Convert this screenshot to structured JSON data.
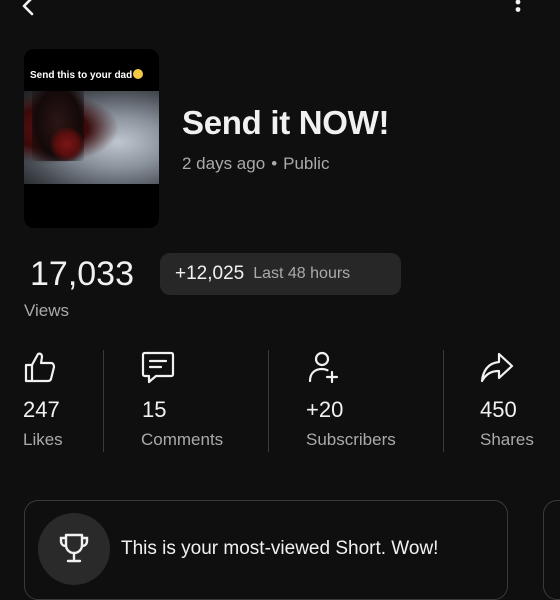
{
  "header": {
    "back_icon": "chevron-left-icon",
    "more_icon": "more-vertical-icon"
  },
  "video": {
    "thumbnail_caption": "Send this to your dad",
    "title": "Send it NOW!",
    "age": "2 days ago",
    "separator": "•",
    "visibility": "Public"
  },
  "views": {
    "count": "17,033",
    "label": "Views",
    "delta": "+12,025",
    "delta_period": "Last 48 hours"
  },
  "stats": [
    {
      "icon": "thumbs-up-icon",
      "value": "247",
      "label": "Likes"
    },
    {
      "icon": "comment-icon",
      "value": "15",
      "label": "Comments"
    },
    {
      "icon": "person-add-icon",
      "value": "+20",
      "label": "Subscribers"
    },
    {
      "icon": "share-icon",
      "value": "450",
      "label": "Shares"
    }
  ],
  "insight_card": {
    "icon": "trophy-icon",
    "text": "This is your most-viewed Short. Wow!"
  },
  "colors": {
    "background": "#0f0f0f",
    "text": "#f1f1f1",
    "secondary_text": "#aaaaaa",
    "pill": "#272727"
  }
}
